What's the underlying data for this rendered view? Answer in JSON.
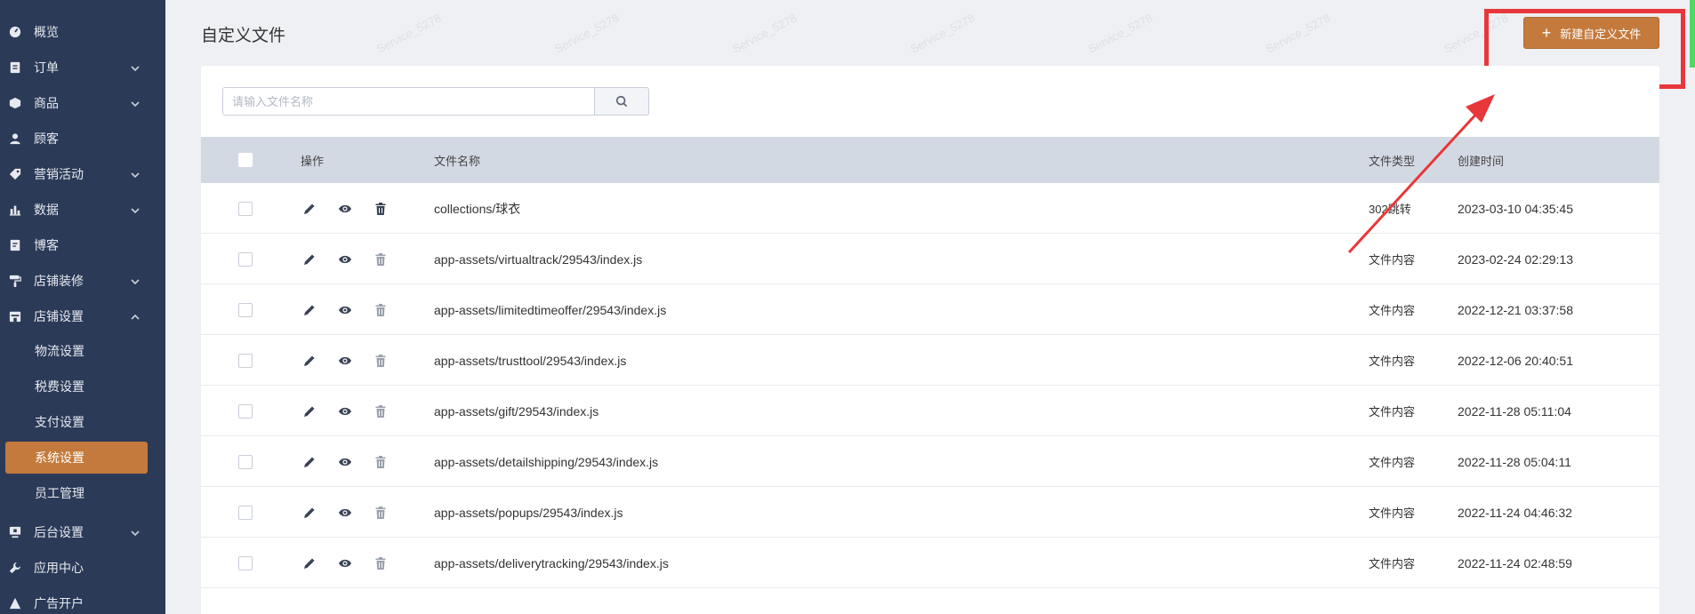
{
  "sidebar": {
    "items": [
      {
        "label": "概览",
        "icon": "dashboard-icon",
        "has_children": false
      },
      {
        "label": "订单",
        "icon": "order-icon",
        "has_children": true
      },
      {
        "label": "商品",
        "icon": "product-icon",
        "has_children": true
      },
      {
        "label": "顾客",
        "icon": "user-icon",
        "has_children": false
      },
      {
        "label": "营销活动",
        "icon": "tag-icon",
        "has_children": true
      },
      {
        "label": "数据",
        "icon": "chart-icon",
        "has_children": true
      },
      {
        "label": "博客",
        "icon": "blog-icon",
        "has_children": false
      },
      {
        "label": "店铺装修",
        "icon": "paint-roller-icon",
        "has_children": true
      },
      {
        "label": "店铺设置",
        "icon": "store-icon",
        "has_children": true,
        "expanded": true
      }
    ],
    "sub_items": [
      {
        "label": "物流设置",
        "active": false
      },
      {
        "label": "税费设置",
        "active": false
      },
      {
        "label": "支付设置",
        "active": false
      },
      {
        "label": "系统设置",
        "active": true
      },
      {
        "label": "员工管理",
        "active": false
      }
    ],
    "bottom_items": [
      {
        "label": "后台设置",
        "icon": "monitor-icon",
        "has_children": true
      },
      {
        "label": "应用中心",
        "icon": "wrench-icon",
        "has_children": false
      },
      {
        "label": "广告开户",
        "icon": "ad-icon",
        "has_children": false
      }
    ]
  },
  "page": {
    "title": "自定义文件",
    "new_button_label": "新建自定义文件"
  },
  "search": {
    "placeholder": "请输入文件名称",
    "value": ""
  },
  "table": {
    "columns": {
      "actions": "操作",
      "name": "文件名称",
      "type": "文件类型",
      "created": "创建时间"
    },
    "rows": [
      {
        "name": "collections/球衣",
        "type": "302跳转",
        "created": "2023-03-10 04:35:45"
      },
      {
        "name": "app-assets/virtualtrack/29543/index.js",
        "type": "文件内容",
        "created": "2023-02-24 02:29:13"
      },
      {
        "name": "app-assets/limitedtimeoffer/29543/index.js",
        "type": "文件内容",
        "created": "2022-12-21 03:37:58"
      },
      {
        "name": "app-assets/trusttool/29543/index.js",
        "type": "文件内容",
        "created": "2022-12-06 20:40:51"
      },
      {
        "name": "app-assets/gift/29543/index.js",
        "type": "文件内容",
        "created": "2022-11-28 05:11:04"
      },
      {
        "name": "app-assets/detailshipping/29543/index.js",
        "type": "文件内容",
        "created": "2022-11-28 05:04:11"
      },
      {
        "name": "app-assets/popups/29543/index.js",
        "type": "文件内容",
        "created": "2022-11-24 04:46:32"
      },
      {
        "name": "app-assets/deliverytracking/29543/index.js",
        "type": "文件内容",
        "created": "2022-11-24 02:48:59"
      }
    ]
  },
  "watermark": "Service_5278",
  "colors": {
    "sidebar_bg": "#2b3a57",
    "accent": "#c47a3c",
    "annotation": "#e8373a"
  }
}
